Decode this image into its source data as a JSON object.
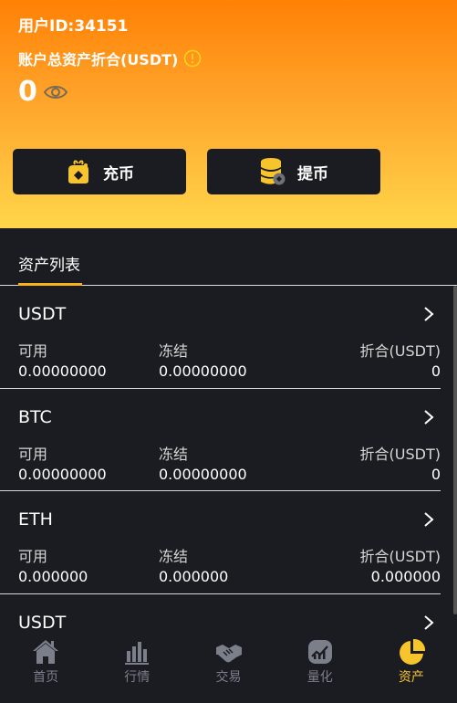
{
  "header": {
    "user_id": "用户ID:34151",
    "assets_label": "账户总资产折合(USDT)",
    "total_value": "0"
  },
  "actions": {
    "deposit_label": "充币",
    "withdraw_label": "提币"
  },
  "list": {
    "tab_label": "资产列表",
    "col_available": "可用",
    "col_frozen": "冻结",
    "col_converted": "折合(USDT)",
    "items": [
      {
        "name": "USDT",
        "available": "0.00000000",
        "frozen": "0.00000000",
        "converted": "0"
      },
      {
        "name": "BTC",
        "available": "0.00000000",
        "frozen": "0.00000000",
        "converted": "0"
      },
      {
        "name": "ETH",
        "available": "0.000000",
        "frozen": "0.000000",
        "converted": "0.000000"
      },
      {
        "name": "USDT",
        "available": "",
        "frozen": "",
        "converted": ""
      }
    ]
  },
  "tabbar": {
    "items": [
      {
        "label": "首页",
        "icon": "home-icon"
      },
      {
        "label": "行情",
        "icon": "bar-chart-icon"
      },
      {
        "label": "交易",
        "icon": "handshake-icon"
      },
      {
        "label": "量化",
        "icon": "quant-icon"
      },
      {
        "label": "资产",
        "icon": "pie-chart-icon"
      }
    ],
    "active_color": "#f7c42b",
    "inactive_color": "#7b7f8a"
  },
  "colors": {
    "header_gradient_top": "#ff8105",
    "header_gradient_bottom": "#ffd64a",
    "background": "#1b1c21",
    "accent": "#f7b21b"
  }
}
